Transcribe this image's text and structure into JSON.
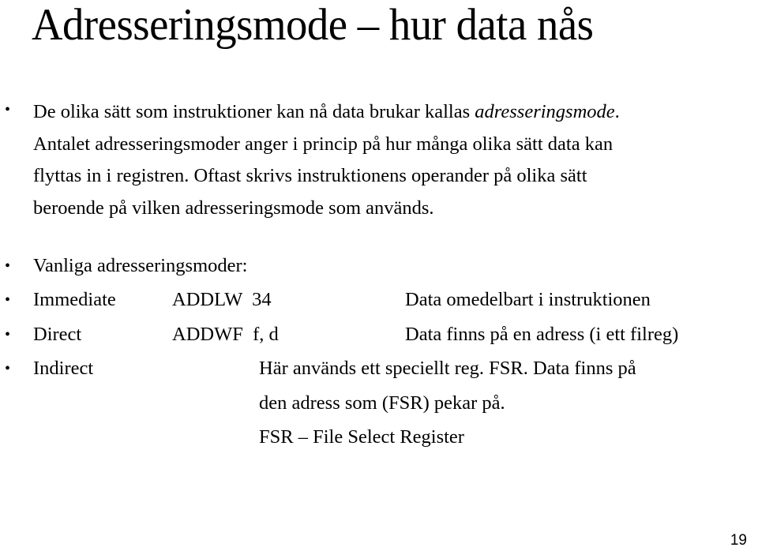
{
  "slide": {
    "title": "Adresseringsmode – hur data nås",
    "bullet_char": "•",
    "intro": {
      "lines": [
        {
          "before": "De olika sätt som instruktioner kan nå data brukar kallas ",
          "italic": "adresseringsmode",
          "after": "."
        },
        {
          "text": "Antalet adresseringsmoder anger i princip på hur många olika sätt data kan"
        },
        {
          "text": "flyttas in i registren. Oftast skrivs instruktionens operander på olika sätt"
        },
        {
          "text": "beroende på vilken adresseringsmode som används."
        }
      ]
    },
    "modes_heading": "Vanliga adresseringsmoder:",
    "modes": [
      {
        "name": "Immediate",
        "example": "ADDLW  34",
        "description": "Data omedelbart i instruktionen"
      },
      {
        "name": "Direct",
        "example": "ADDWF  f, d",
        "description": "Data finns på en adress (i ett filreg)"
      },
      {
        "name": "Indirect",
        "example": "",
        "description_lines": [
          "Här används ett speciellt reg. FSR. Data finns på",
          "den adress som (FSR) pekar på.",
          "FSR – File Select Register"
        ]
      }
    ],
    "page_number": "19"
  }
}
